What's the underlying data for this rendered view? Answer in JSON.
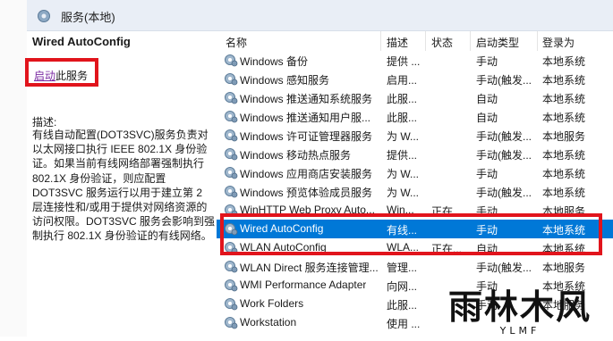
{
  "header": {
    "title": "服务(本地)",
    "icon": "services-gear-icon"
  },
  "detail": {
    "service_name": "Wired AutoConfig",
    "start_link": "启动",
    "start_suffix": "此服务",
    "desc_label": "描述:",
    "description": "有线自动配置(DOT3SVC)服务负责对以太网接口执行 IEEE 802.1X 身份验证。如果当前有线网络部署强制执行 802.1X 身份验证，则应配置 DOT3SVC 服务运行以用于建立第 2 层连接性和/或用于提供对网络资源的访问权限。DOT3SVC 服务会影响到强制执行 802.1X 身份验证的有线网络。"
  },
  "columns": {
    "name": "名称",
    "desc": "描述",
    "status": "状态",
    "startup": "启动类型",
    "logon": "登录为"
  },
  "rows": [
    {
      "name": "Windows 备份",
      "desc": "提供 ...",
      "status": "",
      "startup": "手动",
      "logon": "本地系统"
    },
    {
      "name": "Windows 感知服务",
      "desc": "启用...",
      "status": "",
      "startup": "手动(触发...",
      "logon": "本地系统"
    },
    {
      "name": "Windows 推送通知系统服务",
      "desc": "此服...",
      "status": "",
      "startup": "自动",
      "logon": "本地系统"
    },
    {
      "name": "Windows 推送通知用户服...",
      "desc": "此服...",
      "status": "",
      "startup": "自动",
      "logon": "本地系统"
    },
    {
      "name": "Windows 许可证管理器服务",
      "desc": "为 W...",
      "status": "",
      "startup": "手动(触发...",
      "logon": "本地服务"
    },
    {
      "name": "Windows 移动热点服务",
      "desc": "提供...",
      "status": "",
      "startup": "手动(触发...",
      "logon": "本地系统"
    },
    {
      "name": "Windows 应用商店安装服务",
      "desc": "为 W...",
      "status": "",
      "startup": "手动",
      "logon": "本地系统"
    },
    {
      "name": "Windows 预览体验成员服务",
      "desc": "为 W...",
      "status": "",
      "startup": "手动(触发...",
      "logon": "本地系统"
    },
    {
      "name": "WinHTTP Web Proxy Auto...",
      "desc": "Win...",
      "status": "正在...",
      "startup": "手动",
      "logon": "本地服务"
    },
    {
      "name": "Wired AutoConfig",
      "desc": "有线...",
      "status": "",
      "startup": "手动",
      "logon": "本地系统",
      "selected": true
    },
    {
      "name": "WLAN AutoConfig",
      "desc": "WLA...",
      "status": "正在...",
      "startup": "自动",
      "logon": "本地系统"
    },
    {
      "name": "WLAN Direct 服务连接管理...",
      "desc": "管理...",
      "status": "",
      "startup": "手动(触发...",
      "logon": "本地服务"
    },
    {
      "name": "WMI Performance Adapter",
      "desc": "向网...",
      "status": "",
      "startup": "手动",
      "logon": "本地系统"
    },
    {
      "name": "Work Folders",
      "desc": "此服...",
      "status": "",
      "startup": "手动",
      "logon": "本地服务"
    },
    {
      "name": "Workstation",
      "desc": "使用 ...",
      "status": "",
      "startup": "",
      "logon": ""
    }
  ],
  "watermark": {
    "main": "雨林木风",
    "sub": "YLMF"
  },
  "colors": {
    "selected": "#0078d7",
    "highlight_box": "#e1141c",
    "link": "#7b2ba3"
  }
}
